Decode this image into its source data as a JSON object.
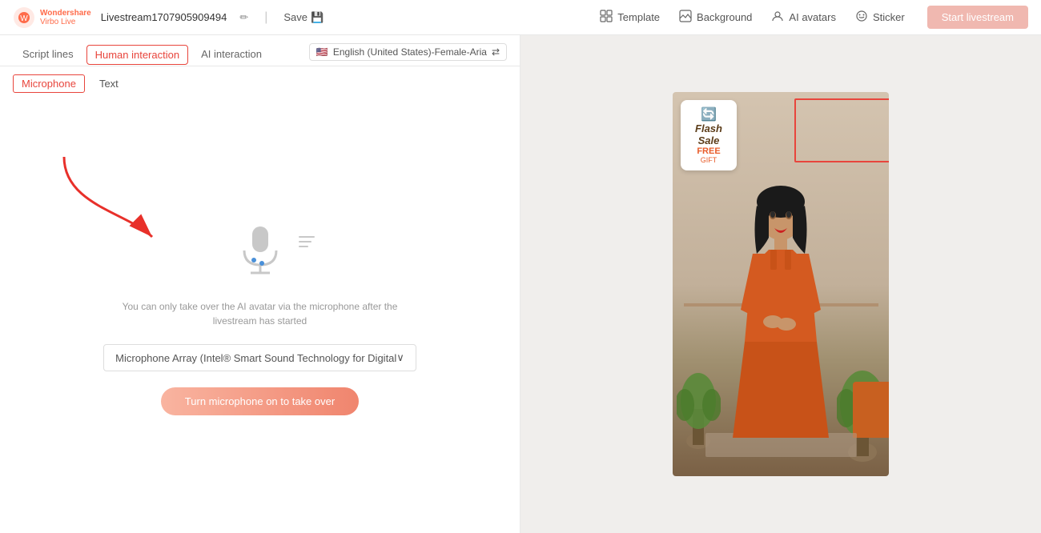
{
  "app": {
    "logo_line1": "Wondershare",
    "logo_line2": "Virbo Live",
    "title": "Livestream1707905909494",
    "save_label": "Save",
    "divider": "|"
  },
  "topbar": {
    "template_label": "Template",
    "background_label": "Background",
    "ai_avatars_label": "AI avatars",
    "sticker_label": "Sticker",
    "start_btn_label": "Start livestream"
  },
  "tabs": {
    "script_lines": "Script lines",
    "human_interaction": "Human interaction",
    "ai_interaction": "AI interaction"
  },
  "lang_selector": {
    "flag": "🇺🇸",
    "label": "English (United States)-Female-Aria"
  },
  "sub_tabs": {
    "microphone": "Microphone",
    "text": "Text"
  },
  "content": {
    "hint_text": "You can only take over the AI avatar via the microphone after the livestream has started",
    "dropdown_label": "Microphone Array (Intel® Smart Sound Technology for Digital",
    "dropdown_chevron": "∨",
    "cta_label": "Turn microphone on to take over"
  },
  "flash_sale": {
    "title": "Flash Sale",
    "free": "FREE",
    "gift": "GIFT"
  },
  "icons": {
    "edit": "✏",
    "save": "💾",
    "template": "⊞",
    "background": "▣",
    "ai_avatars": "◉",
    "sticker": "★",
    "mic": "🎤",
    "chevron_down": "∨",
    "flag_us": "🇺🇸",
    "swap": "⇄"
  }
}
